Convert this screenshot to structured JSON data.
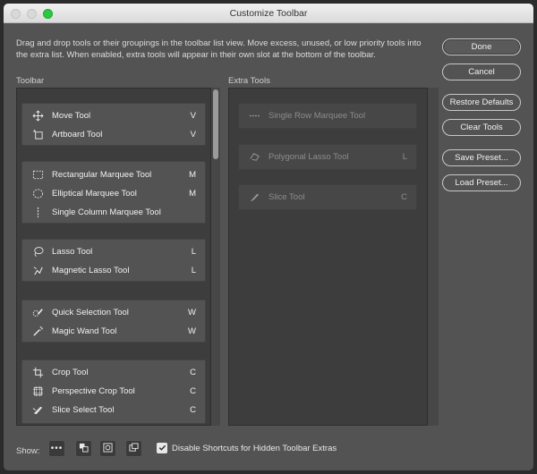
{
  "window": {
    "title": "Customize Toolbar"
  },
  "description": "Drag and drop tools or their groupings in the toolbar list view. Move excess, unused, or low priority tools into the extra list. When enabled, extra tools will appear in their own slot at the bottom of the toolbar.",
  "buttons": {
    "done": "Done",
    "cancel": "Cancel",
    "restore_defaults": "Restore Defaults",
    "clear_tools": "Clear Tools",
    "save_preset": "Save Preset...",
    "load_preset": "Load Preset..."
  },
  "toolbar": {
    "label": "Toolbar",
    "groups": [
      {
        "tools": [
          {
            "label": "Move Tool",
            "key": "V",
            "icon": "move-icon"
          },
          {
            "label": "Artboard Tool",
            "key": "V",
            "icon": "artboard-icon"
          }
        ]
      },
      {
        "tools": [
          {
            "label": "Rectangular Marquee Tool",
            "key": "M",
            "icon": "rect-marquee-icon"
          },
          {
            "label": "Elliptical Marquee Tool",
            "key": "M",
            "icon": "ellipse-marquee-icon"
          },
          {
            "label": "Single Column Marquee Tool",
            "key": "",
            "icon": "column-marquee-icon"
          }
        ]
      },
      {
        "tools": [
          {
            "label": "Lasso Tool",
            "key": "L",
            "icon": "lasso-icon"
          },
          {
            "label": "Magnetic Lasso Tool",
            "key": "L",
            "icon": "magnetic-lasso-icon"
          }
        ]
      },
      {
        "tools": [
          {
            "label": "Quick Selection Tool",
            "key": "W",
            "icon": "quick-selection-icon"
          },
          {
            "label": "Magic Wand Tool",
            "key": "W",
            "icon": "magic-wand-icon"
          }
        ]
      },
      {
        "tools": [
          {
            "label": "Crop Tool",
            "key": "C",
            "icon": "crop-icon"
          },
          {
            "label": "Perspective Crop Tool",
            "key": "C",
            "icon": "perspective-crop-icon"
          },
          {
            "label": "Slice Select Tool",
            "key": "C",
            "icon": "slice-select-icon"
          }
        ]
      }
    ]
  },
  "extra_tools": {
    "label": "Extra Tools",
    "items": [
      {
        "label": "Single Row Marquee Tool",
        "key": "",
        "icon": "row-marquee-icon"
      },
      {
        "label": "Polygonal Lasso Tool",
        "key": "L",
        "icon": "polygonal-lasso-icon"
      },
      {
        "label": "Slice Tool",
        "key": "C",
        "icon": "slice-icon"
      }
    ]
  },
  "footer": {
    "show_label": "Show:",
    "checkbox_label": "Disable Shortcuts for Hidden Toolbar Extras",
    "checkbox_checked": true
  }
}
